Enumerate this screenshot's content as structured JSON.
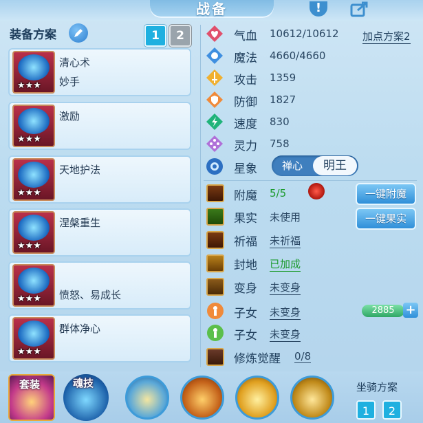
{
  "header": {
    "title": "战备"
  },
  "equipment": {
    "title": "装备方案",
    "plans": [
      "1",
      "2"
    ],
    "skills": [
      {
        "name": "清心术",
        "sub": "妙手",
        "stars": "★★★"
      },
      {
        "name": "激励",
        "sub": "",
        "stars": "★★★"
      },
      {
        "name": "天地护法",
        "sub": "",
        "stars": "★★★"
      },
      {
        "name": "涅槃重生",
        "sub": "",
        "stars": "★★★"
      },
      {
        "name": "",
        "sub": "愤怒、易成长",
        "stars": "★★★"
      },
      {
        "name": "群体净心",
        "sub": "",
        "stars": "★★★"
      }
    ]
  },
  "attributes": {
    "scheme_link": "加点方案2",
    "stats": [
      {
        "label": "气血",
        "value": "10612/10612",
        "icon": "heart-icon",
        "color": "#e0506c"
      },
      {
        "label": "魔法",
        "value": "4660/4660",
        "icon": "mana-icon",
        "color": "#3f8fe0"
      },
      {
        "label": "攻击",
        "value": "1359",
        "icon": "sword-icon",
        "color": "#f0b030"
      },
      {
        "label": "防御",
        "value": "1827",
        "icon": "shield-icon",
        "color": "#f08a3a"
      },
      {
        "label": "速度",
        "value": "830",
        "icon": "speed-icon",
        "color": "#20b37a"
      },
      {
        "label": "灵力",
        "value": "758",
        "icon": "spirit-icon",
        "color": "#b070d8"
      }
    ],
    "star": {
      "label": "星象",
      "options": [
        "禅心",
        "明王"
      ],
      "selected": "明王"
    }
  },
  "functions": {
    "items": [
      {
        "label": "附魔",
        "value": "5/5",
        "icon": "enchant-icon"
      },
      {
        "label": "果实",
        "value": "未使用",
        "icon": "fruit-icon"
      },
      {
        "label": "祈福",
        "value": "未祈福",
        "icon": "bless-icon"
      },
      {
        "label": "封地",
        "value": "已加成",
        "icon": "fief-icon"
      },
      {
        "label": "变身",
        "value": "未变身",
        "icon": "transform-icon"
      },
      {
        "label": "子女",
        "value": "未变身",
        "icon": "child-icon"
      },
      {
        "label": "子女",
        "value": "未变身",
        "icon": "child-icon"
      },
      {
        "label": "修炼觉醒",
        "value": "0/8",
        "icon": "cultivation-icon"
      }
    ],
    "enchant_button": "一键附魔",
    "fruit_button": "一键果实",
    "counter": "2885",
    "plus": "+"
  },
  "bottom": {
    "suit_label": "套装",
    "soul_label": "魂技",
    "mount_plan_label": "坐骑方案",
    "mount_plans": [
      "1",
      "2"
    ]
  },
  "colors": {
    "accent": "#1fb0e0",
    "bg": "#c6e1f3",
    "green": "#1b9a2c"
  }
}
